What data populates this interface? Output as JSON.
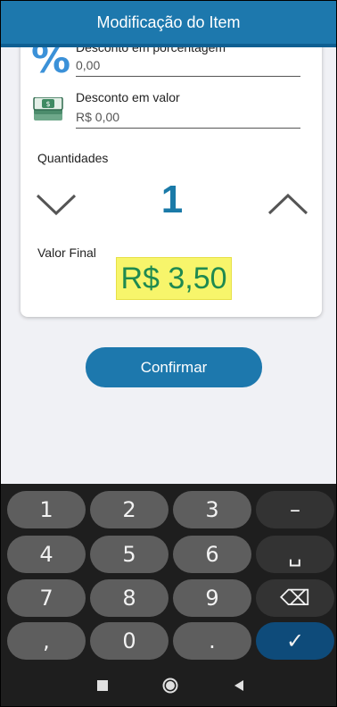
{
  "header": {
    "title": "Modificação do Item"
  },
  "discount_percent": {
    "label": "Desconto em porcentagem",
    "value": "0,00",
    "icon": "percent-icon"
  },
  "discount_value": {
    "label": "Desconto em valor",
    "value": "R$ 0,00",
    "icon": "money-icon"
  },
  "quantity": {
    "label": "Quantidades",
    "value": "1"
  },
  "final": {
    "label": "Valor Final",
    "value": "R$ 3,50"
  },
  "confirm": {
    "label": "Confirmar"
  },
  "keyboard": {
    "keys": [
      "1",
      "2",
      "3",
      "–",
      "4",
      "5",
      "6",
      "␣",
      "7",
      "8",
      "9",
      "⌫",
      ",",
      "0",
      ".",
      "✓"
    ]
  },
  "colors": {
    "brand": "#1d78ad",
    "highlight": "#f7f56b",
    "price": "#1f8a50"
  }
}
